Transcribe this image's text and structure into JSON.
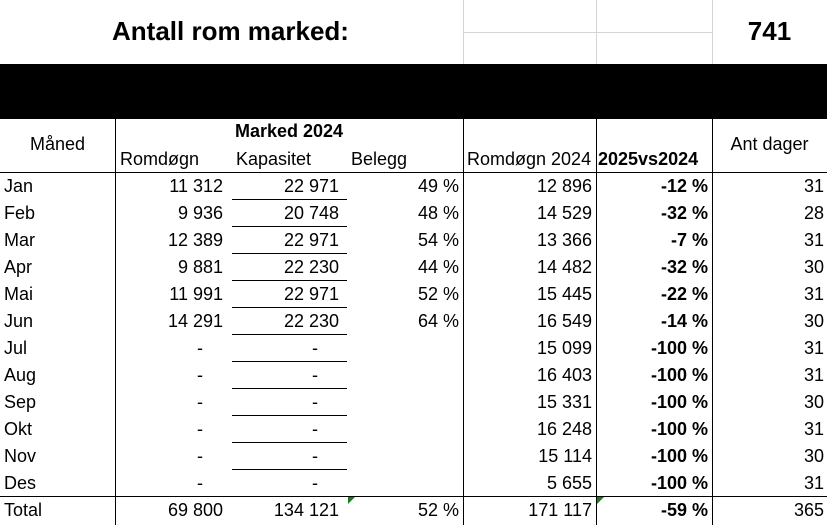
{
  "title": {
    "label": "Antall rom marked:",
    "value": "741"
  },
  "headers": {
    "month": "Måned",
    "group": "Marked 2024",
    "romdogn": "Romdøgn",
    "kapasitet": "Kapasitet",
    "belegg": "Belegg",
    "romdogn2024": "Romdøgn 2024",
    "vs": "2025vs2024",
    "days": "Ant dager"
  },
  "rows": [
    {
      "month": "Jan",
      "romdogn": "11 312",
      "kapasitet": "22 971",
      "belegg": "49 %",
      "romdogn2024": "12 896",
      "vs": "-12 %",
      "days": "31"
    },
    {
      "month": "Feb",
      "romdogn": "9 936",
      "kapasitet": "20 748",
      "belegg": "48 %",
      "romdogn2024": "14 529",
      "vs": "-32 %",
      "days": "28"
    },
    {
      "month": "Mar",
      "romdogn": "12 389",
      "kapasitet": "22 971",
      "belegg": "54 %",
      "romdogn2024": "13 366",
      "vs": "-7 %",
      "days": "31"
    },
    {
      "month": "Apr",
      "romdogn": "9 881",
      "kapasitet": "22 230",
      "belegg": "44 %",
      "romdogn2024": "14 482",
      "vs": "-32 %",
      "days": "30"
    },
    {
      "month": "Mai",
      "romdogn": "11 991",
      "kapasitet": "22 971",
      "belegg": "52 %",
      "romdogn2024": "15 445",
      "vs": "-22 %",
      "days": "31"
    },
    {
      "month": "Jun",
      "romdogn": "14 291",
      "kapasitet": "22 230",
      "belegg": "64 %",
      "romdogn2024": "16 549",
      "vs": "-14 %",
      "days": "30"
    },
    {
      "month": "Jul",
      "romdogn": "-",
      "kapasitet": "-",
      "belegg": "",
      "romdogn2024": "15 099",
      "vs": "-100 %",
      "days": "31"
    },
    {
      "month": "Aug",
      "romdogn": "-",
      "kapasitet": "-",
      "belegg": "",
      "romdogn2024": "16 403",
      "vs": "-100 %",
      "days": "31"
    },
    {
      "month": "Sep",
      "romdogn": "-",
      "kapasitet": "-",
      "belegg": "",
      "romdogn2024": "15 331",
      "vs": "-100 %",
      "days": "30"
    },
    {
      "month": "Okt",
      "romdogn": "-",
      "kapasitet": "-",
      "belegg": "",
      "romdogn2024": "16 248",
      "vs": "-100 %",
      "days": "31"
    },
    {
      "month": "Nov",
      "romdogn": "-",
      "kapasitet": "-",
      "belegg": "",
      "romdogn2024": "15 114",
      "vs": "-100 %",
      "days": "30"
    },
    {
      "month": "Des",
      "romdogn": "-",
      "kapasitet": "-",
      "belegg": "",
      "romdogn2024": "5 655",
      "vs": "-100 %",
      "days": "31"
    }
  ],
  "total": {
    "month": "Total",
    "romdogn": "69 800",
    "kapasitet": "134 121",
    "belegg": "52 %",
    "romdogn2024": "171 117",
    "vs": "-59 %",
    "days": "365"
  }
}
